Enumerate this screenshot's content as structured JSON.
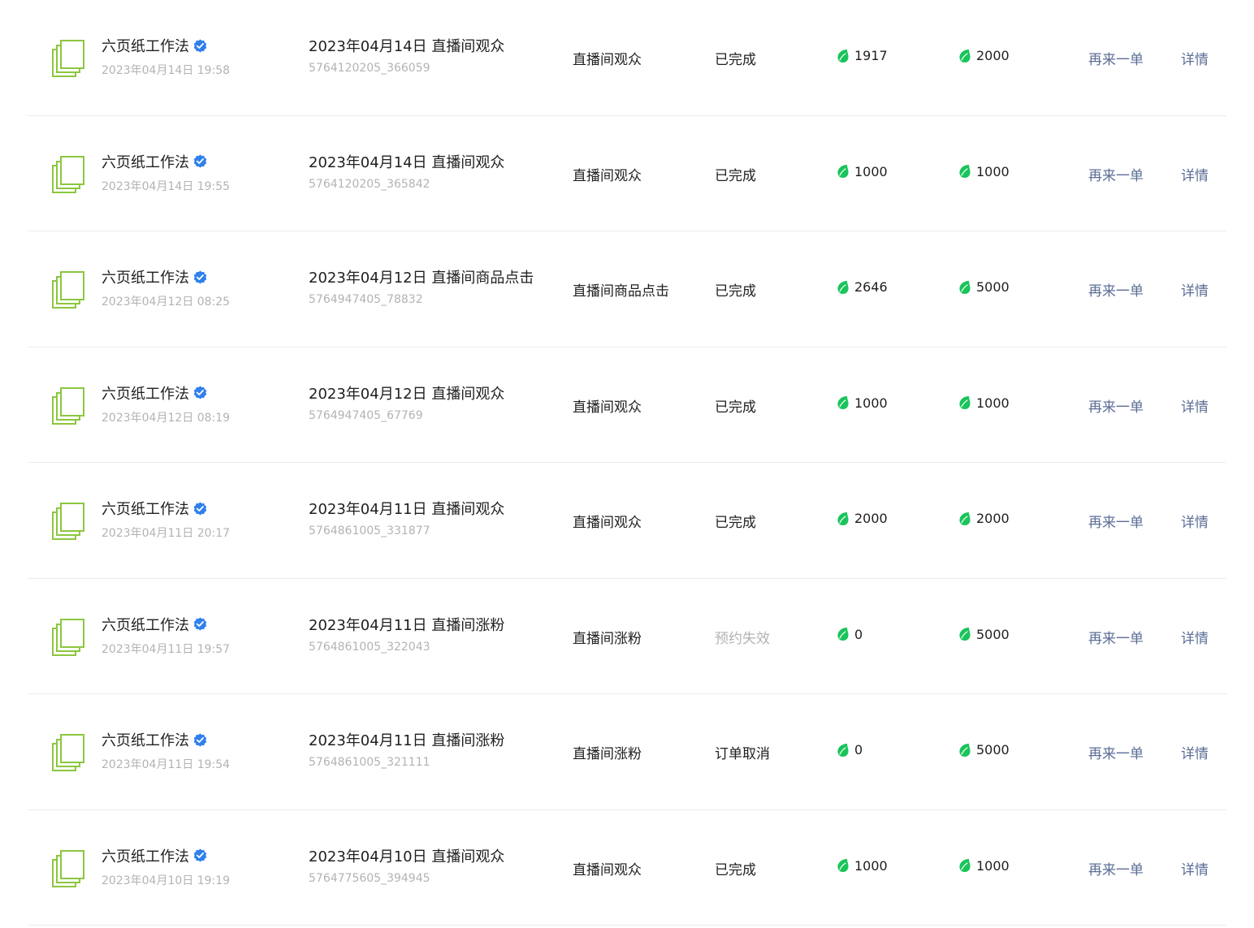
{
  "colors": {
    "accent_green": "#19c45a",
    "verified_blue": "#2f80ed",
    "link": "#5b6e96",
    "muted": "#b3b3b3",
    "thumb_green": "#8cc63f"
  },
  "icons": {
    "thumbnail": "stacked-pages-icon",
    "verified": "verified-badge-icon",
    "quantity": "green-drop-icon"
  },
  "actions": {
    "reorder": "再来一单",
    "detail": "详情"
  },
  "orders": [
    {
      "account": "六页纸工作法",
      "time": "2023年04月14日 19:58",
      "title": "2023年04月14日 直播间观众",
      "order_id": "5764120205_366059",
      "service": "直播间观众",
      "status": "已完成",
      "status_muted": false,
      "delivered": "1917",
      "total": "2000"
    },
    {
      "account": "六页纸工作法",
      "time": "2023年04月14日 19:55",
      "title": "2023年04月14日 直播间观众",
      "order_id": "5764120205_365842",
      "service": "直播间观众",
      "status": "已完成",
      "status_muted": false,
      "delivered": "1000",
      "total": "1000"
    },
    {
      "account": "六页纸工作法",
      "time": "2023年04月12日 08:25",
      "title": "2023年04月12日 直播间商品点击",
      "order_id": "5764947405_78832",
      "service": "直播间商品点击",
      "status": "已完成",
      "status_muted": false,
      "delivered": "2646",
      "total": "5000"
    },
    {
      "account": "六页纸工作法",
      "time": "2023年04月12日 08:19",
      "title": "2023年04月12日 直播间观众",
      "order_id": "5764947405_67769",
      "service": "直播间观众",
      "status": "已完成",
      "status_muted": false,
      "delivered": "1000",
      "total": "1000"
    },
    {
      "account": "六页纸工作法",
      "time": "2023年04月11日 20:17",
      "title": "2023年04月11日 直播间观众",
      "order_id": "5764861005_331877",
      "service": "直播间观众",
      "status": "已完成",
      "status_muted": false,
      "delivered": "2000",
      "total": "2000"
    },
    {
      "account": "六页纸工作法",
      "time": "2023年04月11日 19:57",
      "title": "2023年04月11日 直播间涨粉",
      "order_id": "5764861005_322043",
      "service": "直播间涨粉",
      "status": "预约失效",
      "status_muted": true,
      "delivered": "0",
      "total": "5000"
    },
    {
      "account": "六页纸工作法",
      "time": "2023年04月11日 19:54",
      "title": "2023年04月11日 直播间涨粉",
      "order_id": "5764861005_321111",
      "service": "直播间涨粉",
      "status": "订单取消",
      "status_muted": false,
      "delivered": "0",
      "total": "5000"
    },
    {
      "account": "六页纸工作法",
      "time": "2023年04月10日 19:19",
      "title": "2023年04月10日 直播间观众",
      "order_id": "5764775605_394945",
      "service": "直播间观众",
      "status": "已完成",
      "status_muted": false,
      "delivered": "1000",
      "total": "1000"
    }
  ]
}
